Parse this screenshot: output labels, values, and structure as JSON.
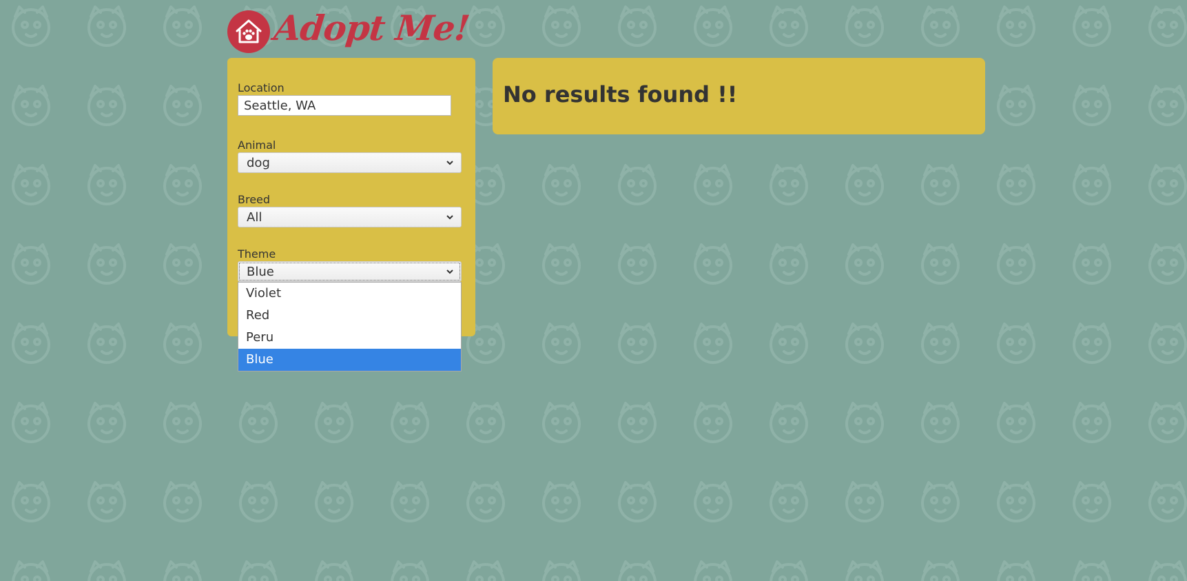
{
  "app": {
    "title": "Adopt Me!",
    "brand_color": "#c43544",
    "background_color": "#80a69b",
    "panel_color": "#d9bf46",
    "logo_icon": "house-paw-icon"
  },
  "search_form": {
    "location": {
      "label": "Location",
      "value": "Seattle, WA"
    },
    "animal": {
      "label": "Animal",
      "value": "dog"
    },
    "breed": {
      "label": "Breed",
      "value": "All"
    },
    "theme": {
      "label": "Theme",
      "value": "Blue",
      "options": [
        "Violet",
        "Red",
        "Peru",
        "Blue"
      ],
      "highlight_color": "#3584e4"
    }
  },
  "results": {
    "message": "No results found !!"
  }
}
